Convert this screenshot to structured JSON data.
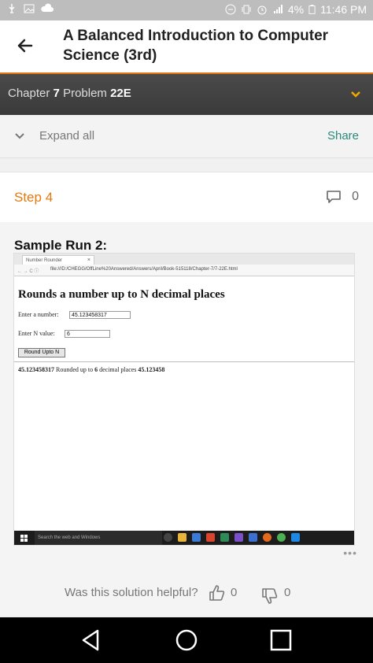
{
  "status_bar": {
    "battery": "4%",
    "time": "11:46 PM"
  },
  "header": {
    "title": "A Balanced Introduction to Computer Science (3rd)"
  },
  "chapter_bar": {
    "chapter_prefix": "Chapter",
    "chapter_num": "7",
    "problem_prefix": "Problem",
    "problem_num": "22E"
  },
  "toolbar": {
    "expand_label": "Expand all",
    "share_label": "Share"
  },
  "step": {
    "label": "Step 4",
    "comment_count": "0"
  },
  "content": {
    "sample_title": "Sample Run 2:",
    "browser": {
      "tab_title": "Number Rounder",
      "tab_close": "×",
      "url": "file:///D:/CHEGG/OffLine%20Answered/Answers/April/Book-515118/Chapter-7/7-22E.html",
      "page_heading": "Rounds a number up to N decimal places",
      "number_label": "Enter a number:",
      "number_value": "45.123458317",
      "n_label": "Enter N value:",
      "n_value": "6",
      "round_button": "Round Upto N",
      "result_number": "45.123458317",
      "result_mid1": "Rounded up to",
      "result_n": "6",
      "result_mid2": "decimal places",
      "result_value": "45.123458"
    },
    "taskbar": {
      "search_placeholder": "Search the web and Windows"
    }
  },
  "feedback": {
    "question": "Was this solution helpful?",
    "upvotes": "0",
    "downvotes": "0"
  },
  "colors": {
    "accent_orange": "#e47a0e",
    "share_teal": "#2a8a7d",
    "chapter_bar": "#404040"
  }
}
